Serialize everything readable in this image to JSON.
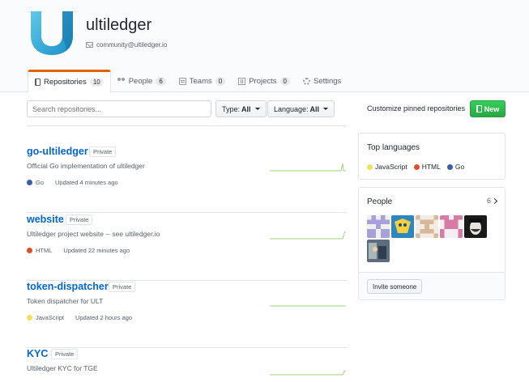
{
  "org": {
    "name": "ultiledger",
    "email": "community@ultiledger.io"
  },
  "tabs": [
    {
      "label": "Repositories",
      "count": "10",
      "icon": "repo-icon"
    },
    {
      "label": "People",
      "count": "6",
      "icon": "people-icon"
    },
    {
      "label": "Teams",
      "count": "0",
      "icon": "team-icon"
    },
    {
      "label": "Projects",
      "count": "0",
      "icon": "project-icon"
    },
    {
      "label": "Settings",
      "count": "",
      "icon": "gear-icon"
    }
  ],
  "filters": {
    "search_placeholder": "Search repositories...",
    "type_label": "Type:",
    "type_value": "All",
    "language_label": "Language:",
    "language_value": "All",
    "customize_label": "Customize pinned repositories",
    "new_label": "New"
  },
  "repos": [
    {
      "name": "go-ultiledger",
      "visibility": "Private",
      "description": "Official Go implementation of ultiledger",
      "language": "Go",
      "language_color": "#375eab",
      "updated": "Updated 4 minutes ago"
    },
    {
      "name": "website",
      "visibility": "Private",
      "description": "Ultiledger project website -- see ultiledger.io",
      "language": "HTML",
      "language_color": "#e34c26",
      "updated": "Updated 22 minutes ago"
    },
    {
      "name": "token-dispatcher",
      "visibility": "Private",
      "description": "Token dispatcher for ULT",
      "language": "JavaScript",
      "language_color": "#f1e05a",
      "updated": "Updated 2 hours ago"
    },
    {
      "name": "KYC",
      "visibility": "Private",
      "description": "Ultiledger KYC for TGE",
      "language": "",
      "language_color": "",
      "updated": ""
    }
  ],
  "sidebar": {
    "top_languages_title": "Top languages",
    "languages": [
      {
        "name": "JavaScript",
        "color": "#f1e05a"
      },
      {
        "name": "HTML",
        "color": "#e34c26"
      },
      {
        "name": "Go",
        "color": "#375eab"
      }
    ],
    "people_title": "People",
    "people_count": "6",
    "invite_label": "Invite someone"
  },
  "colors": {
    "accent_tab": "#e36209",
    "link": "#0366d6",
    "new_button": "#28a745",
    "sparkline": "#9cd47a"
  }
}
